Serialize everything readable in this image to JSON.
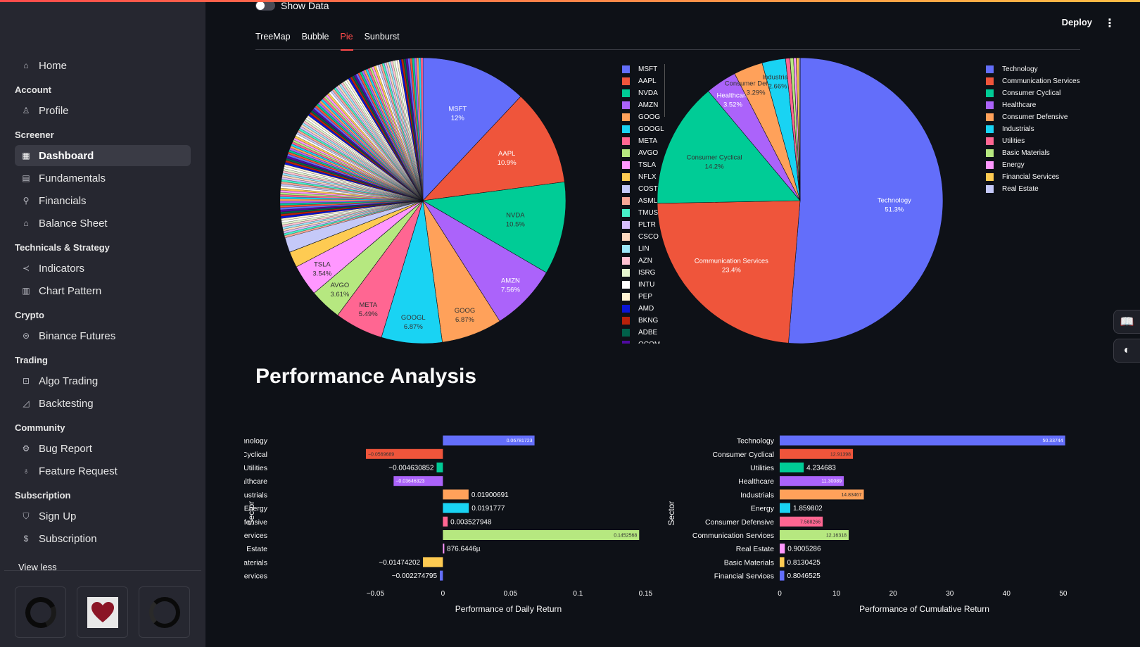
{
  "sidebar": {
    "home": "Home",
    "sections": [
      {
        "title": "Account",
        "items": [
          {
            "label": "Profile",
            "icon": "user-icon",
            "glyph": "♙"
          }
        ]
      },
      {
        "title": "Screener",
        "items": [
          {
            "label": "Dashboard",
            "icon": "dashboard-icon",
            "glyph": "▦",
            "active": true
          },
          {
            "label": "Fundamentals",
            "icon": "document-icon",
            "glyph": "▤"
          },
          {
            "label": "Financials",
            "icon": "chart-icon",
            "glyph": "⚲"
          },
          {
            "label": "Balance Sheet",
            "icon": "bank-icon",
            "glyph": "⌂"
          }
        ]
      },
      {
        "title": "Technicals & Strategy",
        "items": [
          {
            "label": "Indicators",
            "icon": "indicator-icon",
            "glyph": "≺"
          },
          {
            "label": "Chart Pattern",
            "icon": "chart-pattern-icon",
            "glyph": "▥"
          }
        ]
      },
      {
        "title": "Crypto",
        "items": [
          {
            "label": "Binance Futures",
            "icon": "coin-icon",
            "glyph": "⊜"
          }
        ]
      },
      {
        "title": "Trading",
        "items": [
          {
            "label": "Algo Trading",
            "icon": "robot-icon",
            "glyph": "⊡"
          },
          {
            "label": "Backtesting",
            "icon": "backtest-icon",
            "glyph": "◿"
          }
        ]
      },
      {
        "title": "Community",
        "items": [
          {
            "label": "Bug Report",
            "icon": "bug-icon",
            "glyph": "⚙"
          },
          {
            "label": "Feature Request",
            "icon": "lightbulb-icon",
            "glyph": "♁"
          }
        ]
      },
      {
        "title": "Subscription",
        "items": [
          {
            "label": "Sign Up",
            "icon": "shield-icon",
            "glyph": "⛉"
          },
          {
            "label": "Subscription",
            "icon": "dollar-icon",
            "glyph": "$"
          }
        ]
      }
    ],
    "view_less": "View less"
  },
  "header": {
    "show_data_label": "Show Data",
    "deploy_label": "Deploy",
    "menu_glyph": "⋮"
  },
  "tabs": [
    "TreeMap",
    "Bubble",
    "Pie",
    "Sunburst"
  ],
  "active_tab": "Pie",
  "side_buttons": {
    "book_glyph": "📖",
    "theme_glyph": "◐"
  },
  "performance_title": "Performance Analysis",
  "colors": {
    "blue": "#636efa",
    "red": "#ef553b",
    "green": "#00cc96",
    "purple": "#ab63fa",
    "orange": "#ffa15a",
    "cyan": "#19d3f3",
    "pink": "#ff6692",
    "lime": "#b6e880",
    "magenta": "#ff97ff",
    "yellow": "#fecb52"
  },
  "chart_data": [
    {
      "type": "pie",
      "title": "",
      "labels": [
        "MSFT",
        "AAPL",
        "NVDA",
        "AMZN",
        "GOOG",
        "GOOGL",
        "META",
        "AVGO",
        "TSLA",
        "NFLX",
        "COST"
      ],
      "values": [
        12,
        10.9,
        10.5,
        7.56,
        6.87,
        6.87,
        5.49,
        3.61,
        3.54,
        1.79,
        1.69
      ],
      "text_labels": [
        "12%",
        "10.9%",
        "10.5%",
        "7.56%",
        "6.87%",
        "6.87%",
        "5.49%",
        "3.61%",
        "3.54%",
        "",
        ""
      ],
      "remainder_note": "many small slices",
      "legend": [
        "MSFT",
        "AAPL",
        "NVDA",
        "AMZN",
        "GOOG",
        "GOOGL",
        "META",
        "AVGO",
        "TSLA",
        "NFLX",
        "COST",
        "ASML",
        "TMUS",
        "PLTR",
        "CSCO",
        "LIN",
        "AZN",
        "ISRG",
        "INTU",
        "PEP",
        "AMD",
        "BKNG",
        "ADBE",
        "QCOM"
      ],
      "legend_colors": [
        "#636efa",
        "#ef553b",
        "#00cc96",
        "#ab63fa",
        "#ffa15a",
        "#19d3f3",
        "#ff6692",
        "#b6e880",
        "#ff97ff",
        "#fecb52",
        "#c5c9f8",
        "#f7a696",
        "#47f0c8",
        "#d6bdfb",
        "#fcd7bd",
        "#9be6f8",
        "#ffc1d2",
        "#e4f5cf",
        "#ffffff",
        "#fff2d2",
        "#0a15d6",
        "#b8210a",
        "#00614a",
        "#4f0aa0"
      ]
    },
    {
      "type": "pie",
      "title": "",
      "labels": [
        "Technology",
        "Communication Services",
        "Consumer Cyclical",
        "Healthcare",
        "Consumer Defensive",
        "Industrials",
        "Utilities",
        "Basic Materials",
        "Energy",
        "Financial Services",
        "Real Estate"
      ],
      "values": [
        51.3,
        23.4,
        14.2,
        3.52,
        3.29,
        2.66,
        0.5,
        0.4,
        0.3,
        0.3,
        0.13
      ],
      "text_labels": [
        "51.3%",
        "23.4%",
        "14.2%",
        "3.52%",
        "3.29%",
        "2.66%",
        "",
        "",
        "",
        "",
        ""
      ],
      "legend_colors": [
        "#636efa",
        "#ef553b",
        "#00cc96",
        "#ab63fa",
        "#ffa15a",
        "#19d3f3",
        "#ff6692",
        "#b6e880",
        "#ff97ff",
        "#fecb52",
        "#c5c9f8"
      ]
    },
    {
      "type": "bar",
      "orientation": "horizontal",
      "xlabel": "Performance of Daily Return",
      "ylabel": "Sector",
      "xlim": [
        -0.058,
        0.155
      ],
      "xticks": [
        -0.05,
        0,
        0.05,
        0.1,
        0.15
      ],
      "xtick_labels": [
        "−0.05",
        "0",
        "0.05",
        "0.1",
        "0.15"
      ],
      "categories": [
        "Technology",
        "Consumer Cyclical",
        "Utilities",
        "Healthcare",
        "Industrials",
        "Energy",
        "Consumer Defensive",
        "Communication Services",
        "Real Estate",
        "Basic Materials",
        "Financial Services"
      ],
      "values": [
        0.06781723,
        -0.0569689,
        -0.004630852,
        -0.03646323,
        0.01900691,
        0.0191777,
        0.003527948,
        0.1452568,
        0.0008766446,
        -0.01474202,
        -0.002274795
      ],
      "value_labels": [
        "0.06781723",
        "−0.0569689",
        "−0.004630852",
        "−0.03646323",
        "0.01900691",
        "0.0191777",
        "0.003527948",
        "0.1452568",
        "876.6446µ",
        "−0.01474202",
        "−0.002274795"
      ],
      "label_inside": [
        true,
        true,
        false,
        true,
        false,
        false,
        false,
        true,
        false,
        false,
        false
      ],
      "colors": [
        "#636efa",
        "#ef553b",
        "#00cc96",
        "#ab63fa",
        "#ffa15a",
        "#19d3f3",
        "#ff6692",
        "#b6e880",
        "#ff97ff",
        "#fecb52",
        "#636efa"
      ]
    },
    {
      "type": "bar",
      "orientation": "horizontal",
      "xlabel": "Performance of Cumulative Return",
      "ylabel": "Sector",
      "xlim": [
        0,
        51
      ],
      "xticks": [
        0,
        10,
        20,
        30,
        40,
        50
      ],
      "xtick_labels": [
        "0",
        "10",
        "20",
        "30",
        "40",
        "50"
      ],
      "categories": [
        "Technology",
        "Consumer Cyclical",
        "Utilities",
        "Healthcare",
        "Industrials",
        "Energy",
        "Consumer Defensive",
        "Communication Services",
        "Real Estate",
        "Basic Materials",
        "Financial Services"
      ],
      "values": [
        50.33744,
        12.91398,
        4.234683,
        11.30089,
        14.83467,
        1.859802,
        7.588266,
        12.16318,
        0.9005286,
        0.8130425,
        0.8046525
      ],
      "value_labels": [
        "50.33744",
        "12.91398",
        "4.234683",
        "11.30089",
        "14.83467",
        "1.859802",
        "7.588266",
        "12.16318",
        "0.9005286",
        "0.8130425",
        "0.8046525"
      ],
      "label_inside": [
        true,
        true,
        false,
        true,
        true,
        false,
        true,
        true,
        false,
        false,
        false
      ],
      "colors": [
        "#636efa",
        "#ef553b",
        "#00cc96",
        "#ab63fa",
        "#ffa15a",
        "#19d3f3",
        "#ff6692",
        "#b6e880",
        "#ff97ff",
        "#fecb52",
        "#636efa"
      ]
    }
  ]
}
